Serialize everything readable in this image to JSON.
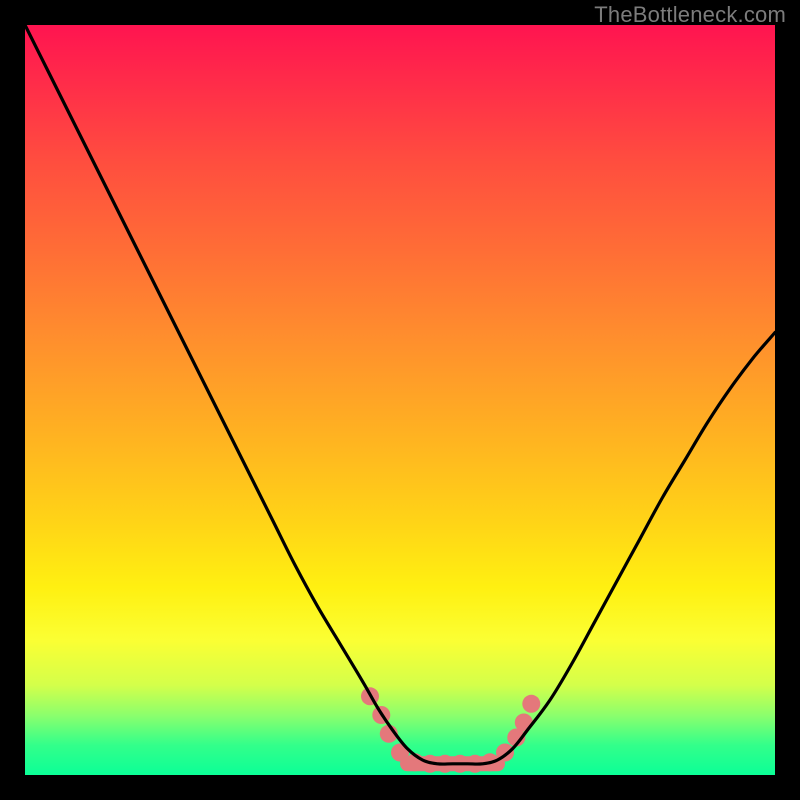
{
  "watermark": "TheBottleneck.com",
  "chart_data": {
    "type": "line",
    "title": "",
    "xlabel": "",
    "ylabel": "",
    "xlim": [
      0,
      100
    ],
    "ylim": [
      0,
      100
    ],
    "background_gradient": {
      "type": "vertical",
      "stops": [
        {
          "pos": 0,
          "color": "#ff1450"
        },
        {
          "pos": 18,
          "color": "#ff4d3f"
        },
        {
          "pos": 42,
          "color": "#ff8f2d"
        },
        {
          "pos": 66,
          "color": "#ffd317"
        },
        {
          "pos": 82,
          "color": "#fbff33"
        },
        {
          "pos": 92,
          "color": "#8cff6c"
        },
        {
          "pos": 100,
          "color": "#0bff97"
        }
      ]
    },
    "series": [
      {
        "name": "bottleneck-curve",
        "stroke": "#000000",
        "x": [
          0,
          3,
          6,
          9,
          12,
          15,
          18,
          21,
          24,
          27,
          30,
          33,
          36,
          39,
          42,
          45,
          47,
          49,
          51,
          53,
          55,
          57,
          59,
          61,
          63,
          65,
          67,
          70,
          73,
          76,
          79,
          82,
          85,
          88,
          91,
          94,
          97,
          100
        ],
        "y": [
          100,
          94,
          88,
          82,
          76,
          70,
          64,
          58,
          52,
          46,
          40,
          34,
          28,
          22.5,
          17.5,
          12.5,
          9,
          6,
          3.5,
          2,
          1.5,
          1.5,
          1.5,
          1.5,
          2,
          3.5,
          6,
          10,
          15,
          20.5,
          26,
          31.5,
          37,
          42,
          47,
          51.5,
          55.5,
          59
        ]
      }
    ],
    "highlight_markers": {
      "color": "#e4787b",
      "radius_px": 9,
      "points_xy": [
        [
          46,
          10.5
        ],
        [
          47.5,
          8
        ],
        [
          48.5,
          5.5
        ],
        [
          50,
          3
        ],
        [
          52,
          1.7
        ],
        [
          54,
          1.5
        ],
        [
          56,
          1.5
        ],
        [
          58,
          1.5
        ],
        [
          60,
          1.5
        ],
        [
          62,
          1.7
        ],
        [
          64,
          3
        ],
        [
          65.5,
          5
        ],
        [
          66.5,
          7
        ],
        [
          67.5,
          9.5
        ]
      ]
    },
    "highlight_bar": {
      "color": "#e4787b",
      "x_range": [
        50,
        64
      ],
      "y": 1.5,
      "thickness_px": 15
    }
  }
}
